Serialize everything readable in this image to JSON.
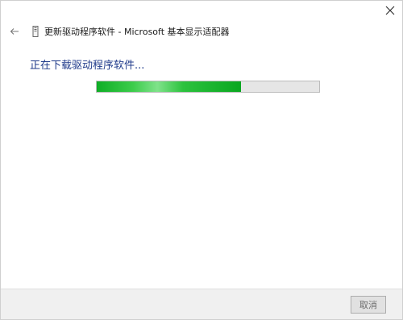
{
  "window": {
    "title": "更新驱动程序软件 - Microsoft 基本显示适配器",
    "close_icon": "close-icon",
    "back_icon": "arrow-left-icon",
    "device_icon": "device-icon"
  },
  "main": {
    "status_text": "正在下载驱动程序软件..."
  },
  "progress": {
    "value": 0.65,
    "fill_color": "#1fb534",
    "track_color": "#e6e6e6"
  },
  "footer": {
    "cancel_label": "取消"
  }
}
